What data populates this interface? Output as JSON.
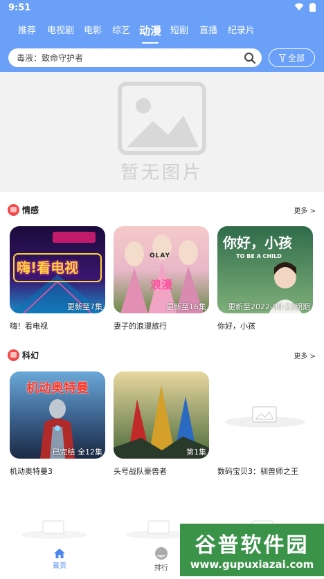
{
  "status": {
    "time": "9:51"
  },
  "tabs": [
    {
      "label": "推荐",
      "active": false
    },
    {
      "label": "电视剧",
      "active": false
    },
    {
      "label": "电影",
      "active": false
    },
    {
      "label": "综艺",
      "active": false
    },
    {
      "label": "动漫",
      "active": true
    },
    {
      "label": "短剧",
      "active": false
    },
    {
      "label": "直播",
      "active": false
    },
    {
      "label": "纪录片",
      "active": false
    }
  ],
  "search": {
    "value": "毒液：致命守护者"
  },
  "filter": {
    "label": "全部"
  },
  "banner": {
    "placeholder_text": "暂无图片"
  },
  "sections": [
    {
      "title": "情感",
      "more": "更多 >",
      "items": [
        {
          "name": "嗨！看电视",
          "episode": "更新至7集",
          "art_text": "嗨!看电视"
        },
        {
          "name": "妻子的浪漫旅行",
          "episode": "更新至16集",
          "art_text": "OLAY"
        },
        {
          "name": "你好，小孩",
          "episode": "更新至2022-08-23期期",
          "art_text": "你好，小孩"
        }
      ]
    },
    {
      "title": "科幻",
      "more": "更多 >",
      "items": [
        {
          "name": "机动奥特曼3",
          "episode": "已完结 全12集",
          "art_text": "机动奥特曼"
        },
        {
          "name": "头号战队豪兽者",
          "episode": "第1集",
          "art_text": ""
        },
        {
          "name": "数码宝贝3：驯兽师之王",
          "episode": "",
          "art_text": ""
        }
      ]
    }
  ],
  "bottom_nav": [
    {
      "label": "首页",
      "active": true
    },
    {
      "label": "排行",
      "active": false
    }
  ],
  "watermark": {
    "title": "谷普软件园",
    "url": "www.gupuxiazai.com"
  },
  "colors": {
    "header": "#6aa0f7",
    "accent": "#4a86f0",
    "badge": "#f04a4a"
  }
}
